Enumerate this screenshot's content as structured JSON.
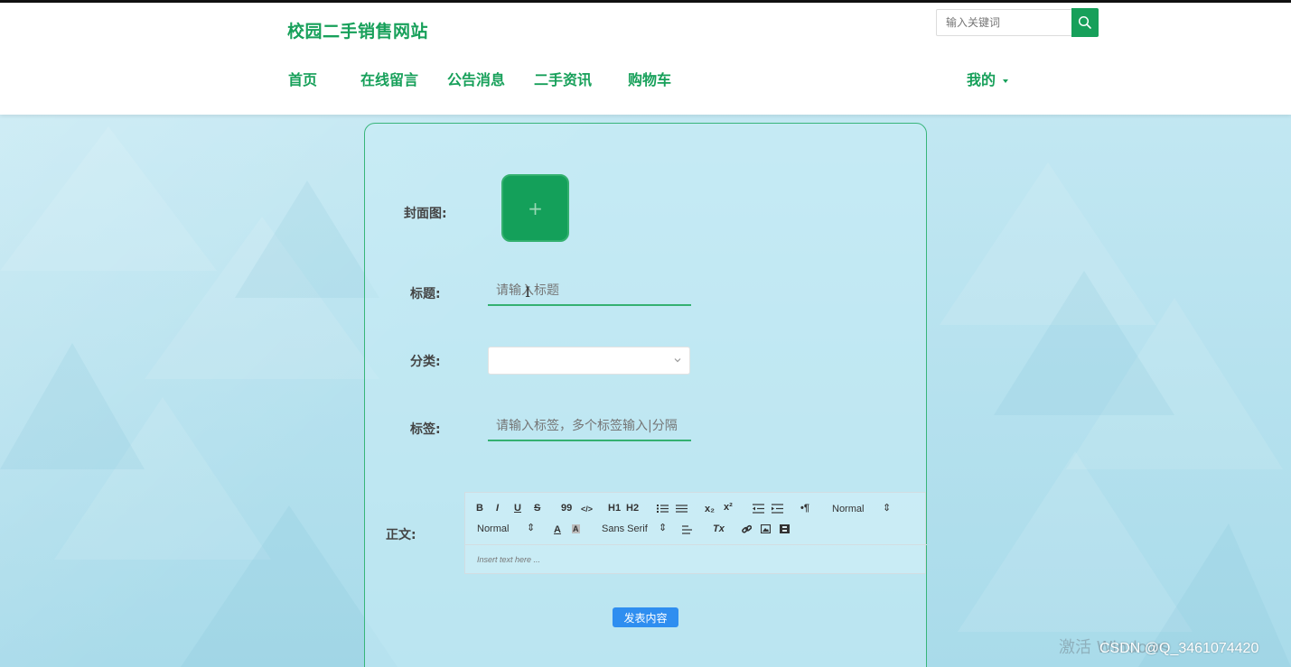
{
  "header": {
    "site_title": "校园二手销售网站",
    "search": {
      "placeholder": "输入关键词",
      "icon": "search-icon"
    },
    "nav": [
      {
        "label": "首页"
      },
      {
        "label": "在线留言"
      },
      {
        "label": "公告消息"
      },
      {
        "label": "二手资讯"
      },
      {
        "label": "购物车"
      }
    ],
    "user_menu": {
      "label": "我的"
    }
  },
  "form": {
    "cover_label": "封面图:",
    "upload_symbol": "+",
    "title_label": "标题:",
    "title_placeholder": "请输入标题",
    "category_label": "分类:",
    "category_value": "",
    "tags_label": "标签:",
    "tags_placeholder": "请输入标签，多个标签输入|分隔",
    "body_label": "正文:",
    "editor": {
      "row1": [
        "B",
        "I",
        "U",
        "S",
        "99",
        "</>",
        "H1",
        "H2",
        "ol",
        "ul",
        "x₂",
        "x²",
        "outdent",
        "indent",
        "rtl",
        "Normal"
      ],
      "row2": [
        "Normal",
        "A",
        "A",
        "Sans Serif",
        "align",
        "Tx",
        "link",
        "image",
        "video"
      ],
      "header_select": "Normal",
      "size_select": "Normal",
      "font_select": "Sans Serif",
      "placeholder": "Insert text here ..."
    },
    "submit_label": "发表内容"
  },
  "colors": {
    "accent": "#17a05a",
    "button_blue": "#2f8ef0",
    "card_border": "#38b57a"
  },
  "watermarks": {
    "windows": "激活 Windows",
    "csdn": "CSDN @Q_3461074420"
  }
}
